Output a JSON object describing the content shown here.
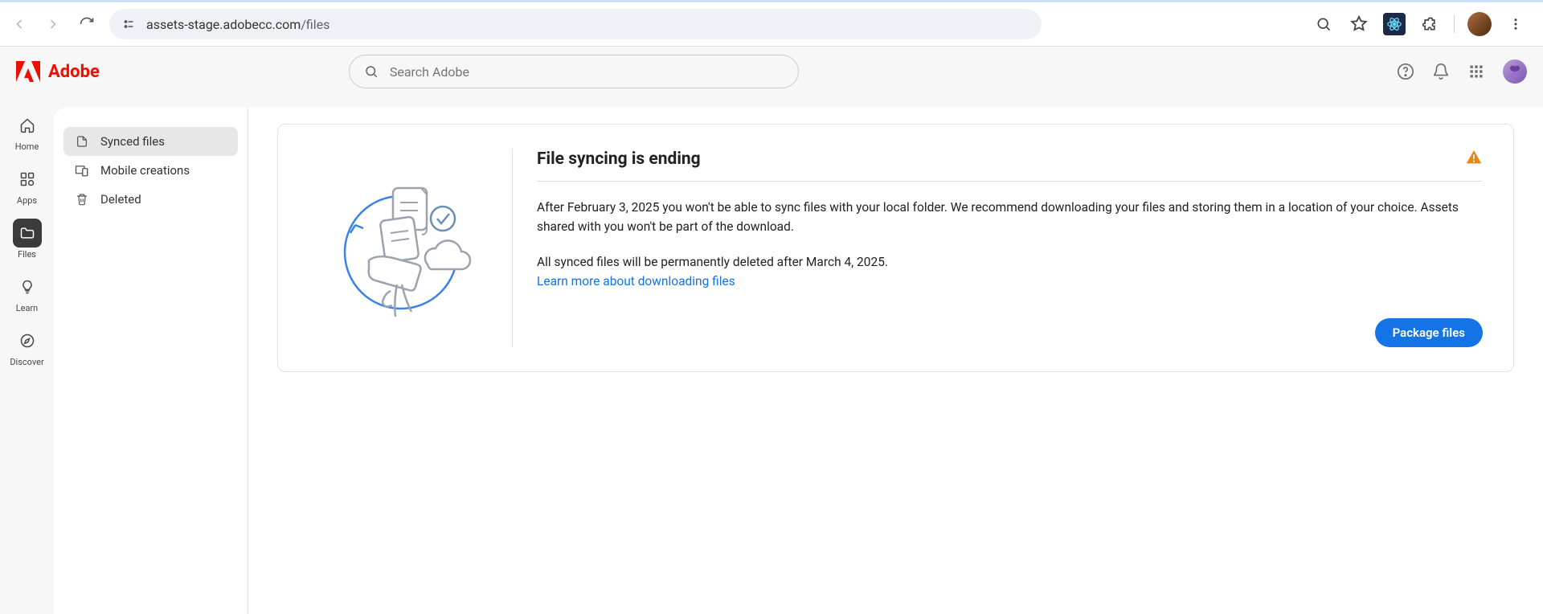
{
  "browser": {
    "url_host": "assets-stage.adobecc.com",
    "url_path": "/files"
  },
  "header": {
    "brand": "Adobe",
    "search_placeholder": "Search Adobe"
  },
  "rail": {
    "items": [
      {
        "label": "Home"
      },
      {
        "label": "Apps"
      },
      {
        "label": "Files"
      },
      {
        "label": "Learn"
      },
      {
        "label": "Discover"
      }
    ]
  },
  "sidepanel": {
    "items": [
      {
        "label": "Synced files"
      },
      {
        "label": "Mobile creations"
      },
      {
        "label": "Deleted"
      }
    ]
  },
  "notice": {
    "heading": "File syncing is ending",
    "paragraph1": "After February 3, 2025 you won't be able to sync files with your local folder. We recommend downloading your files and storing them in a location of your choice. Assets shared with you won't be part of the download.",
    "paragraph2_pre": "All synced files will be permanently deleted after March 4, 2025.",
    "learn_more": "Learn more about downloading files",
    "package_button": "Package files"
  }
}
